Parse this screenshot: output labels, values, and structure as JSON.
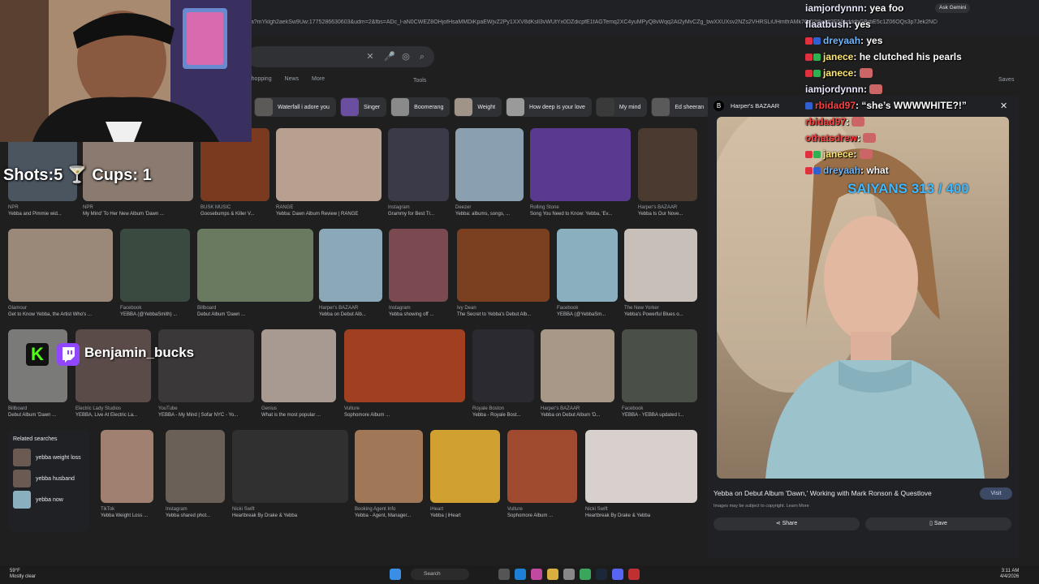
{
  "browser": {
    "url": "2a?mYklgh2aekSw9Uw:1775286630603&udm=2&fbs=ADc_l-aN0CWEZ8OHjofHsaMMDiKpaEWjvZ2Py1XXV8dKsll3vWUtYx0DZdicpfE1fAGTemq2XC4yuMPyQ8vWqq2At2yMvCZg_bwXXUXsv2NZs2VHRSLiUHmtfrAMk7QQ2f8e6ff2F5SkdddhGBrbE5c1Z06OQs3p7Jek2NCOw",
    "ask_gemini": "Ask Gemini",
    "saves": "Saves"
  },
  "search": {
    "tabs": [
      "Shopping",
      "News",
      "More"
    ],
    "tools": "Tools"
  },
  "chips": [
    {
      "label": "Waterfall i adore you",
      "color": "#5c5a58"
    },
    {
      "label": "Singer",
      "color": "#6a4fa0"
    },
    {
      "label": "Boomerang",
      "color": "#8a8a8a"
    },
    {
      "label": "Weight",
      "color": "#a09488"
    },
    {
      "label": "How deep is your love",
      "color": "#9a9a9a"
    },
    {
      "label": "My mind",
      "color": "#3a3a3a"
    },
    {
      "label": "Ed sheeran",
      "color": "#5a5a5a"
    }
  ],
  "results": [
    {
      "src": "NPR",
      "title": "Yebba and Pimmie wid...",
      "color": "#4a5560"
    },
    {
      "src": "NPR",
      "title": "My Mind' To Her New Album 'Dawn ...",
      "color": "#8a7a70"
    },
    {
      "src": "BUSK MUSIC",
      "title": "Goosebumps & Killer V...",
      "color": "#7a3a20"
    },
    {
      "src": "RANGE",
      "title": "Yebba: Dawn Album Review | RANGE",
      "color": "#b8a090"
    },
    {
      "src": "Instagram",
      "title": "Grammy for Best Tr...",
      "color": "#3a3a48"
    },
    {
      "src": "Deezer",
      "title": "Yebba: albums, songs, ...",
      "color": "#8aa0b0"
    },
    {
      "src": "Rolling Stone",
      "title": "Song You Need to Know: Yebba, 'Ev...",
      "color": "#5a3a90"
    },
    {
      "src": "Harper's BAZAAR",
      "title": "Yebba Is Our Nove...",
      "color": "#4a3a30"
    },
    {
      "src": "Glamour",
      "title": "Get to Know Yebba, the Artist Who's ...",
      "color": "#9a8878"
    },
    {
      "src": "Facebook",
      "title": "YEBBA (@YebbaSmith) ...",
      "color": "#3a4a40"
    },
    {
      "src": "Billboard",
      "title": "Debut Album 'Dawn ...",
      "color": "#6a7a60"
    },
    {
      "src": "Harper's BAZAAR",
      "title": "Yebba on Debut Alb...",
      "color": "#8aa8b8"
    },
    {
      "src": "Instagram",
      "title": "Yebba showing off ...",
      "color": "#7a4a50"
    },
    {
      "src": "Ivy Dean",
      "title": "The Secret to Yebba's Debut Alb...",
      "color": "#7a4020"
    },
    {
      "src": "Facebook",
      "title": "YEBBA (@YebbaSm...",
      "color": "#8ab0c0"
    },
    {
      "src": "The New Yorker",
      "title": "Yebba's Powerful Blues o...",
      "color": "#c8c0b8"
    },
    {
      "src": "Billboard",
      "title": "Debut Album 'Dawn ...",
      "color": "#7a7a78"
    },
    {
      "src": "Electric Lady Studios",
      "title": "YEBBA, Live At Electric La...",
      "color": "#5a4a48"
    },
    {
      "src": "YouTube",
      "title": "YEBBA - My Mind | Sofar NYC - Yo...",
      "color": "#3a3838"
    },
    {
      "src": "Genius",
      "title": "What is the most popular ...",
      "color": "#a89a90"
    },
    {
      "src": "Vulture",
      "title": "Sophomore Album ...",
      "color": "#a04020"
    },
    {
      "src": "Royale Boston",
      "title": "Yebba - Royale Bost...",
      "color": "#2a2a30"
    },
    {
      "src": "Harper's BAZAAR",
      "title": "Yebba on Debut Album 'D...",
      "color": "#a89888"
    },
    {
      "src": "Facebook",
      "title": "YEBBA - YEBBA updated t...",
      "color": "#4a5048"
    },
    {
      "src": "TikTok",
      "title": "Yebba Weight Loss ...",
      "color": "#a08070"
    },
    {
      "src": "Instagram",
      "title": "Yebba shared phot...",
      "color": "#6a6058"
    },
    {
      "src": "Nicki Swift",
      "title": "Heartbreak By Drake & Yebba",
      "color": "#303030"
    },
    {
      "src": "Booking Agent Info",
      "title": "Yebba - Agent, Manager...",
      "color": "#a07858"
    },
    {
      "src": "iHeart",
      "title": "Yebba | iHeart",
      "color": "#d0a030"
    },
    {
      "src": "Vulture",
      "title": "Sophomore Album ...",
      "color": "#a04a30"
    },
    {
      "src": "Nicki Swift",
      "title": "Heartbreak By Drake & Yebba",
      "color": "#d8d0cc"
    }
  ],
  "related": {
    "title": "Related searches",
    "items": [
      "yebba weight loss",
      "yebba husband",
      "yebba now"
    ]
  },
  "panel": {
    "source": "Harper's BAZAAR",
    "source_initial": "B",
    "caption": "Yebba on Debut Album 'Dawn,' Working with Mark Ronson & Questlove",
    "visit": "Visit",
    "copyright": "Images may be subject to copyright. Learn More",
    "share": "Share",
    "save": "Save"
  },
  "overlay": {
    "shots_cups": "Shots:5 🍸 Cups: 1",
    "kick": "K",
    "handle": "Benjamin_bucks",
    "counter": "SAIYANS 313 / 400"
  },
  "chat": [
    {
      "user": "iamjordynnn",
      "msg": "yea foo",
      "user_color": "#e8e8ff",
      "badges": []
    },
    {
      "user": "flaatbush",
      "msg": "yes",
      "user_color": "#e8e8ff",
      "badges": []
    },
    {
      "user": "dreyaah",
      "msg": "yes",
      "user_color": "#6fb7ff",
      "badges": [
        "#e03040",
        "#3060d0"
      ]
    },
    {
      "user": "janece",
      "msg": "he clutched his pearls",
      "user_color": "#ffe66a",
      "badges": [
        "#e03040",
        "#30b050"
      ]
    },
    {
      "user": "janece",
      "msg": "",
      "emote": true,
      "user_color": "#ffe66a",
      "badges": [
        "#e03040",
        "#30b050"
      ]
    },
    {
      "user": "iamjordynnn",
      "msg": "",
      "emote": true,
      "user_color": "#e8e8ff",
      "badges": []
    },
    {
      "user": "rbidad97",
      "msg": "“she’s WWWWHITE?!”",
      "user_color": "#ff4040",
      "badges": [
        "#3060d0"
      ]
    },
    {
      "user": "rbidad97",
      "msg": "",
      "emote": true,
      "user_color": "#ff4040",
      "badges": []
    },
    {
      "user": "othatsdrew",
      "msg": "",
      "emote": true,
      "user_color": "#ff4040",
      "badges": []
    },
    {
      "user": "janece",
      "msg": "",
      "emote": true,
      "user_color": "#ffe66a",
      "badges": [
        "#e03040",
        "#30b050"
      ]
    },
    {
      "user": "dreyaah",
      "msg": "what",
      "user_color": "#6fb7ff",
      "badges": [
        "#e03040",
        "#3060d0"
      ]
    }
  ],
  "taskbar": {
    "weather_temp": "59°F",
    "weather_desc": "Mostly clear",
    "search": "Search",
    "time": "3:11 AM",
    "date": "4/4/2026"
  }
}
